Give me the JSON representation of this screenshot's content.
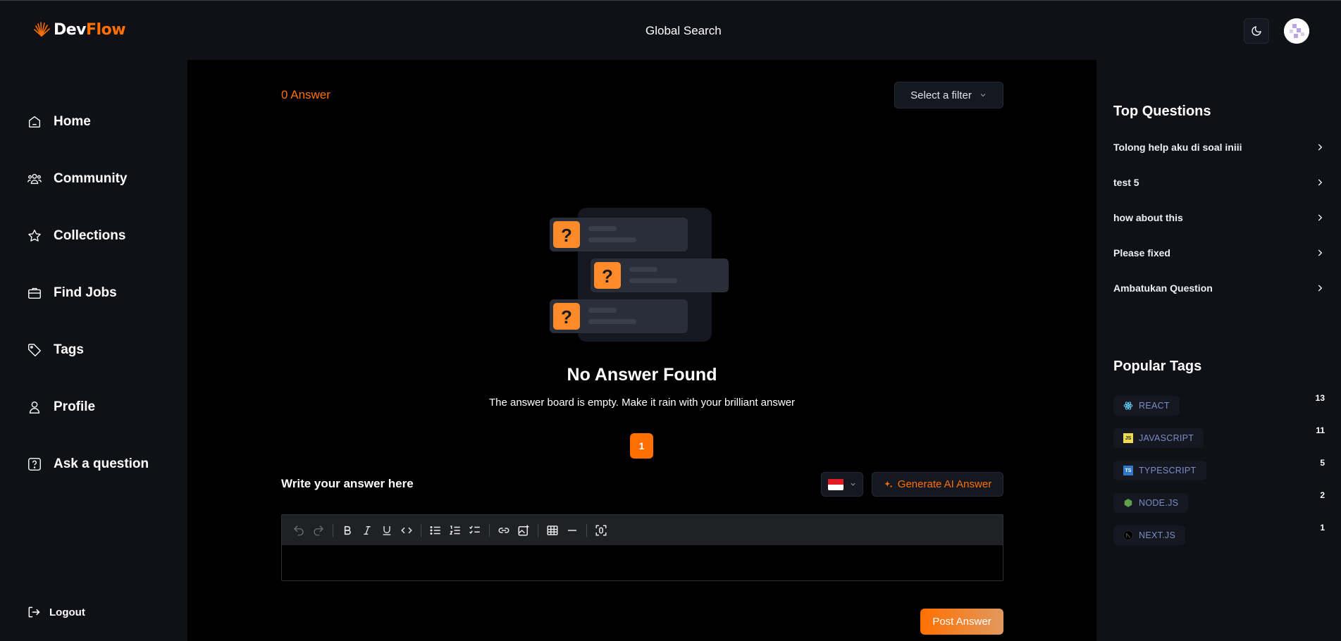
{
  "header": {
    "logo_dev": "Dev",
    "logo_flow": "Flow",
    "search_label": "Global Search"
  },
  "sidebar": {
    "items": [
      {
        "label": "Home",
        "icon": "home-icon"
      },
      {
        "label": "Community",
        "icon": "users-icon"
      },
      {
        "label": "Collections",
        "icon": "star-icon"
      },
      {
        "label": "Find Jobs",
        "icon": "briefcase-icon"
      },
      {
        "label": "Tags",
        "icon": "tag-icon"
      },
      {
        "label": "Profile",
        "icon": "user-icon"
      },
      {
        "label": "Ask a question",
        "icon": "question-icon"
      }
    ],
    "logout_label": "Logout"
  },
  "main": {
    "answer_count": "0 Answer",
    "filter_placeholder": "Select a filter",
    "empty_title": "No Answer Found",
    "empty_description": "The answer board is empty. Make it rain with your brilliant answer",
    "current_page": "1",
    "write_label": "Write your answer here",
    "generate_ai_label": "Generate AI Answer",
    "post_label": "Post Answer"
  },
  "right_sidebar": {
    "top_questions_title": "Top Questions",
    "top_questions": [
      "Tolong help aku di soal iniii",
      "test 5",
      "how about this",
      "Please fixed",
      "Ambatukan Question"
    ],
    "popular_tags_title": "Popular Tags",
    "tags": [
      {
        "name": "REACT",
        "count": "13",
        "icon": "react-icon"
      },
      {
        "name": "JAVASCRIPT",
        "count": "11",
        "icon": "javascript-icon"
      },
      {
        "name": "TYPESCRIPT",
        "count": "5",
        "icon": "typescript-icon"
      },
      {
        "name": "NODE.JS",
        "count": "2",
        "icon": "nodejs-icon"
      },
      {
        "name": "NEXT.JS",
        "count": "1",
        "icon": "nextjs-icon"
      }
    ]
  },
  "colors": {
    "accent": "#ff7000",
    "panel": "#0f1117",
    "background": "#000000",
    "tag_text": "#7b8ec8"
  }
}
